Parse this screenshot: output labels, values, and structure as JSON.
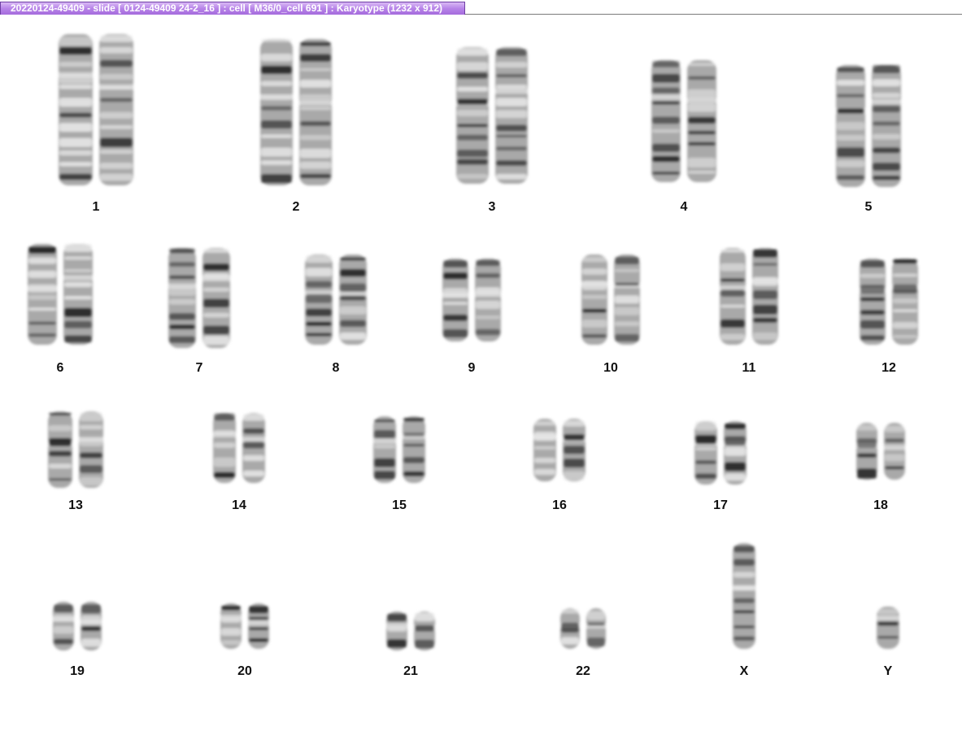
{
  "window": {
    "title": "20220124-49409 - slide [ 0124-49409 24-2_16 ] : cell [ M36/0_cell 691 ] : Karyotype  (1232 x 912)"
  },
  "colors": {
    "title_bar_accent": "#b784e8",
    "chromatid_dark": "#1c1c1c",
    "chromatid_light": "#9a9a9a"
  },
  "karyotype": {
    "labels": [
      "1",
      "2",
      "3",
      "4",
      "5",
      "6",
      "7",
      "8",
      "9",
      "10",
      "11",
      "12",
      "13",
      "14",
      "15",
      "16",
      "17",
      "18",
      "19",
      "20",
      "21",
      "22",
      "X",
      "Y"
    ]
  }
}
